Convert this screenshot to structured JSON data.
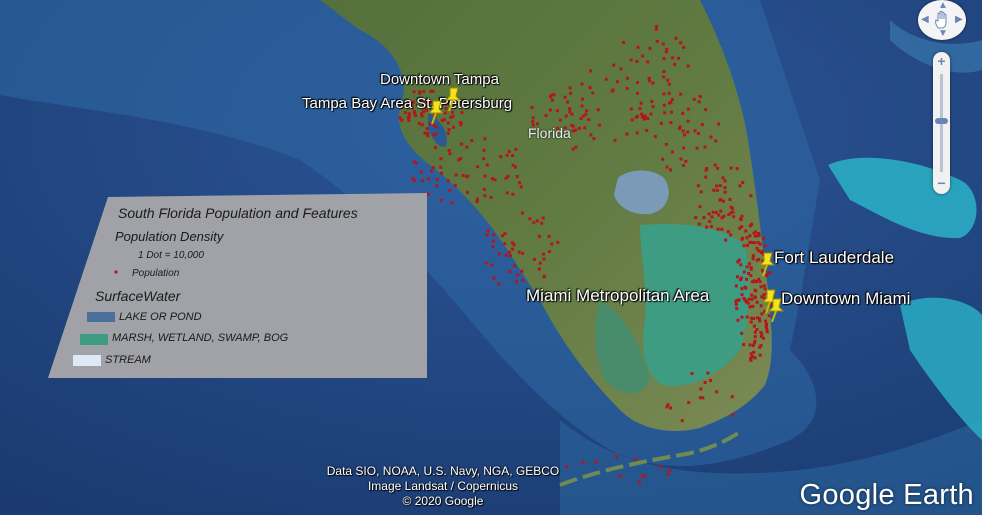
{
  "legend": {
    "title": "South Florida Population and Features",
    "population_heading": "Population Density",
    "dot_scale": "1 Dot = 10,000",
    "population_item": "Population",
    "surface_heading": "SurfaceWater",
    "items": [
      "LAKE OR POND",
      "MARSH, WETLAND, SWAMP, BOG",
      "STREAM"
    ],
    "colors": {
      "dot": "#b3161c",
      "lake": "#4a6f9a",
      "marsh": "#3e9c82",
      "stream": "#dfe8f7",
      "panel": "#a5a5a8"
    }
  },
  "labels": {
    "downtown_tampa": "Downtown Tampa",
    "st_petersburg": "Tampa Bay Area St. Petersburg",
    "florida": "Florida",
    "fort_lauderdale": "Fort Lauderdale",
    "miami_metro": "Miami Metropolitan Area",
    "downtown_miami": "Downtown Miami"
  },
  "attribution": [
    "Data SIO, NOAA, U.S. Navy, NGA, GEBCO",
    "Image Landsat / Copernicus",
    "© 2020 Google"
  ],
  "brand": "Google Earth",
  "icons": {
    "navigate": "hand-icon",
    "zoom_in": "plus-icon",
    "zoom_out": "minus-icon",
    "placemark": "pushpin-icon"
  }
}
